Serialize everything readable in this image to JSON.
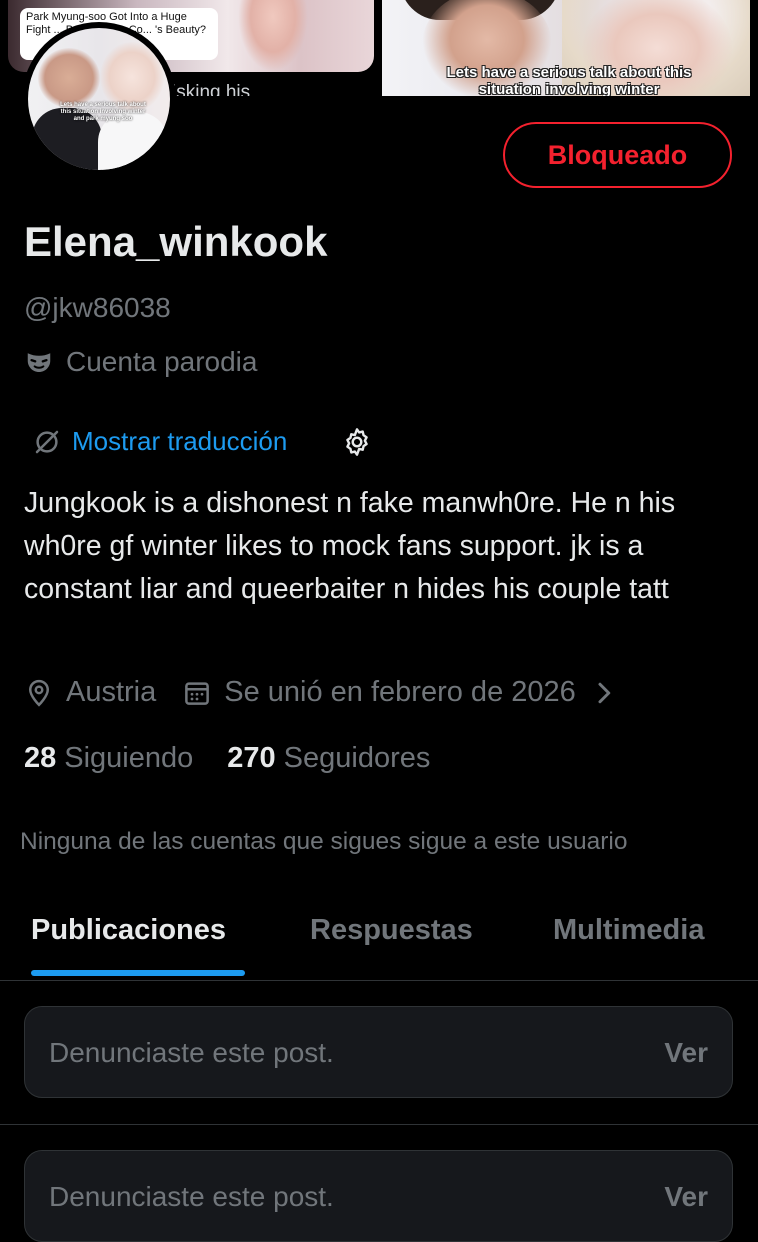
{
  "banner": {
    "left_caption": "Park Myung-soo Got Into a Huge Fight ... Because He Co... 's Beauty?",
    "right_caption": "Lets have a serious talk about this situation involving winter",
    "partial_text": "isking his"
  },
  "avatar": {
    "caption": "Lets have a serious talk about this situation involving winter and park myung soo"
  },
  "profile": {
    "blocked_label": "Bloqueado",
    "display_name": "Elena_winkook",
    "handle": "@jkw86038",
    "parody_label": "Cuenta parodia",
    "translate_label": "Mostrar traducción",
    "bio": "Jungkook is a dishonest n fake manwh0re. He n his wh0re gf winter likes to mock fans support. jk is a constant liar and queerbaiter n hides his couple tatt",
    "location": "Austria",
    "joined": "Se unió en febrero de 2026",
    "following_count": "28",
    "following_label": "Siguiendo",
    "followers_count": "270",
    "followers_label": "Seguidores",
    "mutuals_notice": "Ninguna de las cuentas que sigues sigue a este usuario"
  },
  "tabs": [
    {
      "label": "Publicaciones",
      "active": true
    },
    {
      "label": "Respuestas",
      "active": false
    },
    {
      "label": "Multimedia",
      "active": false
    }
  ],
  "reports": [
    {
      "text": "Denunciaste este post.",
      "action": "Ver"
    },
    {
      "text": "Denunciaste este post.",
      "action": "Ver"
    }
  ],
  "colors": {
    "background": "#000000",
    "accent": "#1d9bf0",
    "danger": "#f4212e",
    "muted": "#71767b",
    "text": "#e7e9ea"
  },
  "icons": [
    "mask-icon",
    "translate-icon",
    "gear-icon",
    "location-icon",
    "calendar-icon",
    "chevron-right-icon"
  ]
}
